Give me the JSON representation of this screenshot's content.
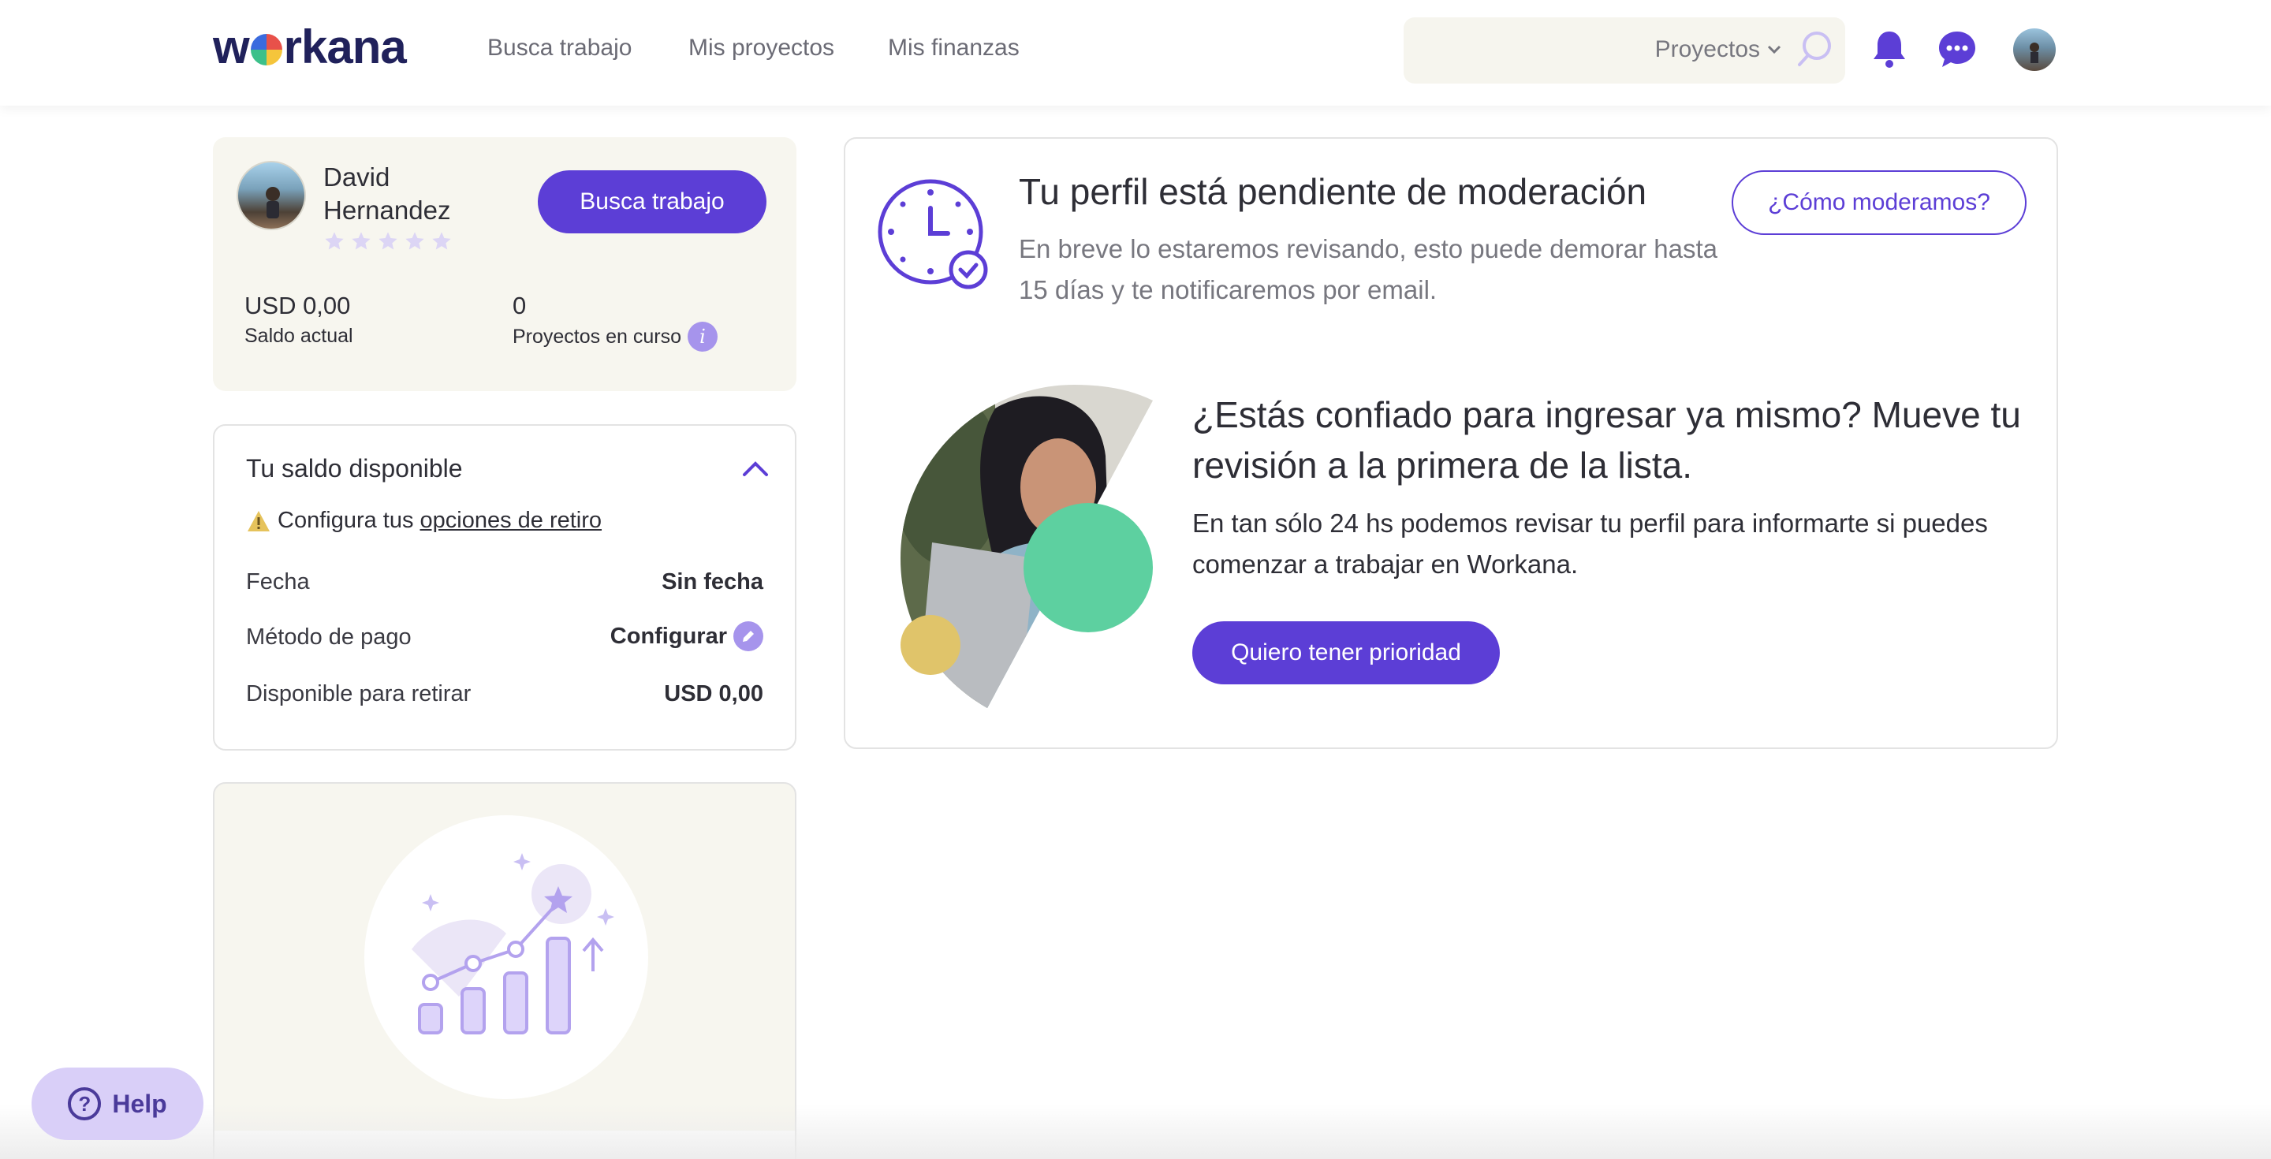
{
  "header": {
    "logo": {
      "before": "w",
      "after": "rkana"
    },
    "nav": [
      "Busca trabajo",
      "Mis proyectos",
      "Mis finanzas"
    ],
    "search": {
      "selected": "Proyectos"
    }
  },
  "profile": {
    "name": "David Hernandez",
    "rating_stars": 0,
    "cta": "Busca trabajo",
    "balance_value": "USD 0,00",
    "balance_label": "Saldo actual",
    "projects_value": "0",
    "projects_label": "Proyectos en curso"
  },
  "balance_card": {
    "title": "Tu saldo disponible",
    "warning_prefix": "Configura tus",
    "warning_link": "opciones de retiro",
    "rows": [
      {
        "label": "Fecha",
        "value": "Sin fecha"
      },
      {
        "label": "Método de pago",
        "value": "Configurar"
      },
      {
        "label": "Disponible para retirar",
        "value": "USD 0,00"
      }
    ]
  },
  "moderation": {
    "title": "Tu perfil está pendiente de moderación",
    "text": "En breve lo estaremos revisando, esto puede demorar hasta 15 días y te notificaremos por email.",
    "button": "¿Cómo moderamos?"
  },
  "priority": {
    "title": "¿Estás confiado para ingresar ya mismo? Mueve tu revisión a la primera de la lista.",
    "text": "En tan sólo 24 hs podemos revisar tu perfil para informarte si puedes comenzar a trabajar en Workana.",
    "button": "Quiero tener prioridad"
  },
  "help": {
    "label": "Help"
  },
  "colors": {
    "primary": "#5c3ed6",
    "primary_light": "#a694ec",
    "card_beige": "#f7f6ef",
    "text": "#2e2e36"
  }
}
